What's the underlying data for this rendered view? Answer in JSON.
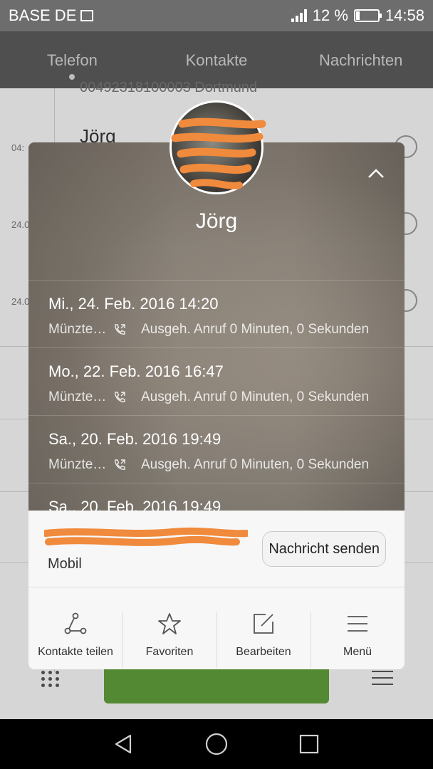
{
  "status_bar": {
    "carrier": "BASE DE",
    "battery_percent": "12 %",
    "time": "14:58"
  },
  "tabs": [
    {
      "label": "Telefon",
      "active": true
    },
    {
      "label": "Kontakte",
      "active": false
    },
    {
      "label": "Nachrichten",
      "active": false
    }
  ],
  "background_list": {
    "top_subtitle": "00492318100003 Dortmund",
    "first_name": "Jörg",
    "times": [
      "04:",
      "24.0",
      "24.0"
    ]
  },
  "contact": {
    "name": "Jörg",
    "calls": [
      {
        "date": "Mi., 24. Feb. 2016 14:20",
        "location": "Münzte…",
        "description": "Ausgeh. Anruf 0 Minuten, 0 Sekunden"
      },
      {
        "date": "Mo., 22. Feb. 2016 16:47",
        "location": "Münzte…",
        "description": "Ausgeh. Anruf 0 Minuten, 0 Sekunden"
      },
      {
        "date": "Sa., 20. Feb. 2016 19:49",
        "location": "Münzte…",
        "description": "Ausgeh. Anruf 0 Minuten, 0 Sekunden"
      },
      {
        "date": "Sa., 20. Feb. 2016 19:49"
      }
    ],
    "number_type": "Mobil",
    "send_message_label": "Nachricht senden"
  },
  "actions": [
    {
      "label": "Kontakte teilen",
      "icon": "share-icon"
    },
    {
      "label": "Favoriten",
      "icon": "star-icon"
    },
    {
      "label": "Bearbeiten",
      "icon": "edit-icon"
    },
    {
      "label": "Menü",
      "icon": "menu-icon"
    }
  ],
  "colors": {
    "accent_redaction": "#f08a3c",
    "call_button": "#5f9c3a"
  }
}
